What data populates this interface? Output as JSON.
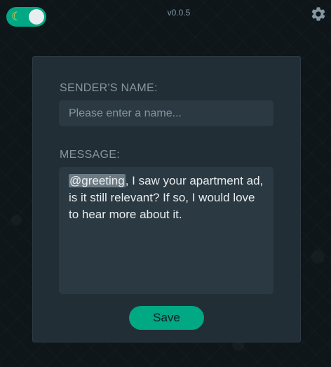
{
  "header": {
    "version": "v0.0.5",
    "theme_toggle_icon": "moon-icon",
    "settings_icon": "gear-icon"
  },
  "form": {
    "sender_label": "SENDER'S NAME:",
    "sender_placeholder": "Please enter a name...",
    "sender_value": "",
    "message_label": "MESSAGE:",
    "message_token": "@greeting",
    "message_rest": ", I saw your apartment ad, is it still relevant? If so, I would love to hear more about it.",
    "save_label": "Save"
  },
  "colors": {
    "accent": "#00a884",
    "background": "#0e161a",
    "card": "#222e35",
    "input": "#2a3942",
    "label": "#8696a0",
    "text": "#e9edef"
  }
}
